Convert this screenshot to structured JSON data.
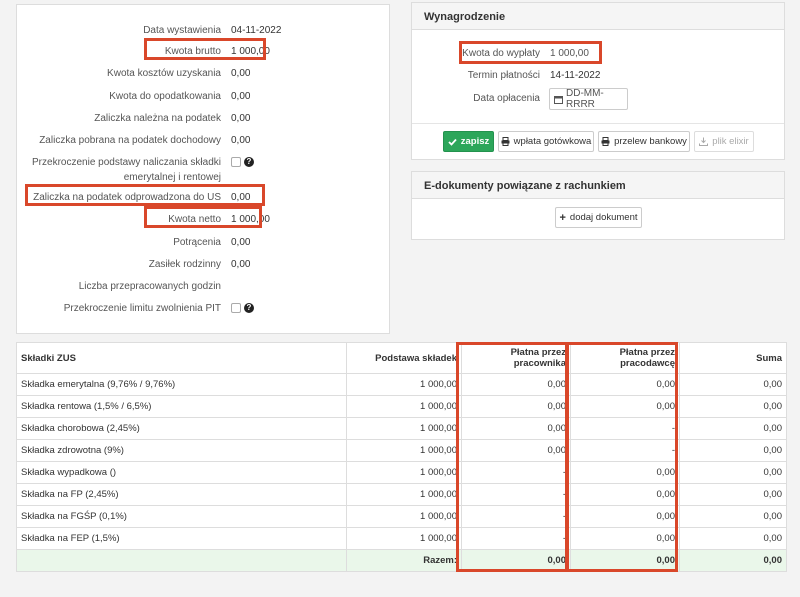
{
  "summary": {
    "rows": [
      {
        "label": "Data wystawienia",
        "value": "04-11-2022"
      },
      {
        "label": "Kwota brutto",
        "value": "1 000,00"
      },
      {
        "label": "Kwota kosztów uzyskania",
        "value": "0,00"
      },
      {
        "label": "Kwota do opodatkowania",
        "value": "0,00"
      },
      {
        "label": "Zaliczka należna na podatek",
        "value": "0,00"
      },
      {
        "label": "Zaliczka pobrana na podatek dochodowy",
        "value": "0,00"
      },
      {
        "label_line1": "Przekroczenie podstawy naliczania składki",
        "label_line2": "emerytalnej i rentowej"
      },
      {
        "label": "Zaliczka na podatek odprowadzona do US",
        "value": "0,00"
      },
      {
        "label": "Kwota netto",
        "value": "1 000,00"
      },
      {
        "label": "Potrącenia",
        "value": "0,00"
      },
      {
        "label": "Zasiłek rodzinny",
        "value": "0,00"
      },
      {
        "label": "Liczba przepracowanych godzin",
        "value": ""
      },
      {
        "label": "Przekroczenie limitu zwolnienia PIT"
      }
    ]
  },
  "wynagrodzenie": {
    "title": "Wynagrodzenie",
    "kwota_label": "Kwota do wypłaty",
    "kwota_value": "1 000,00",
    "termin_label": "Termin płatności",
    "termin_value": "14-11-2022",
    "data_label": "Data opłacenia",
    "data_placeholder": "DD-MM-RRRR",
    "buttons": {
      "zapisz": "zapisz",
      "gotowkowa": "wpłata gotówkowa",
      "przelew": "przelew bankowy",
      "elixir": "plik elixir"
    }
  },
  "edok": {
    "title": "E-dokumenty powiązane z rachunkiem",
    "add_button": "dodaj dokument"
  },
  "zus": {
    "headers": [
      "Składki ZUS",
      "Podstawa składek",
      "Płatna przez pracownika",
      "Płatna przez pracodawcę",
      "Suma"
    ],
    "rows": [
      [
        "Składka emerytalna (9,76% / 9,76%)",
        "1 000,00",
        "0,00",
        "0,00",
        "0,00"
      ],
      [
        "Składka rentowa (1,5% / 6,5%)",
        "1 000,00",
        "0,00",
        "0,00",
        "0,00"
      ],
      [
        "Składka chorobowa (2,45%)",
        "1 000,00",
        "0,00",
        "-",
        "0,00"
      ],
      [
        "Składka zdrowotna (9%)",
        "1 000,00",
        "0,00",
        "-",
        "0,00"
      ],
      [
        "Składka wypadkowa ()",
        "1 000,00",
        "-",
        "0,00",
        "0,00"
      ],
      [
        "Składka na FP (2,45%)",
        "1 000,00",
        "-",
        "0,00",
        "0,00"
      ],
      [
        "Składka na FGŚP (0,1%)",
        "1 000,00",
        "-",
        "0,00",
        "0,00"
      ],
      [
        "Składka na FEP (1,5%)",
        "1 000,00",
        "-",
        "0,00",
        "0,00"
      ]
    ],
    "sum_row": [
      "",
      "Razem:",
      "0,00",
      "0,00",
      "0,00"
    ]
  },
  "colors": {
    "highlight": "#d9472a",
    "success": "#2ca65a",
    "sum_row_bg": "#eaf7ea"
  },
  "icons": [
    "check-icon",
    "print-icon",
    "download-icon",
    "plus-icon",
    "calendar-icon",
    "help-icon"
  ]
}
